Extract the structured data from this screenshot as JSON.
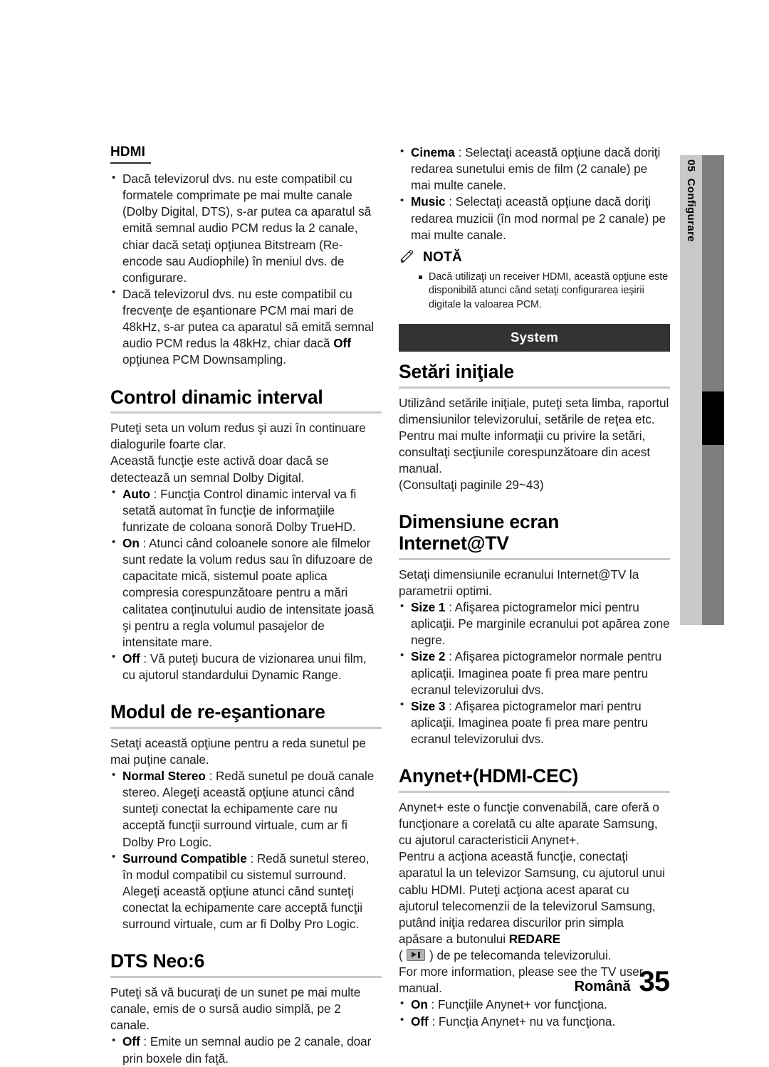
{
  "document": {
    "side_tab": {
      "number": "05",
      "label": "Configurare"
    },
    "footer": {
      "language": "Română",
      "page_number": "35"
    }
  },
  "left_column": {
    "hdmi": {
      "heading": "HDMI",
      "bullets": [
        "Dacă televizorul dvs. nu este compatibil cu formatele comprimate pe mai multe canale (Dolby Digital, DTS), s-ar putea ca aparatul să emită semnal audio PCM redus la 2 canale, chiar dacă setaţi opţiunea Bitstream (Re-encode sau Audiophile) în meniul dvs. de configurare.",
        "Dacă televizorul dvs. nu este compatibil cu frecvenţe de eşantionare PCM mai mari de 48kHz, s-ar putea ca aparatul să emită semnal audio PCM redus la 48kHz, chiar dacă Off opţiunea PCM Downsampling."
      ],
      "bullet2_bold": "Off"
    },
    "dynamic_range": {
      "heading": "Control dinamic interval",
      "intro": [
        "Puteţi seta un volum redus şi auzi în continuare dialogurile foarte clar.",
        "Această funcţie este activă doar dacă se detectează un semnal Dolby Digital."
      ],
      "options": [
        {
          "name": "Auto",
          "sep": " : ",
          "text": "Funcţia Control dinamic interval va fi setată automat în funcţie de informaţiile funrizate de coloana sonoră Dolby TrueHD."
        },
        {
          "name": "On",
          "sep": " : ",
          "text": "Atunci când coloanele sonore ale filmelor sunt redate la volum redus sau în difuzoare de capacitate mică, sistemul poate aplica compresia corespunzătoare pentru a mări calitatea conţinutului audio de intensitate joasă şi pentru a regla volumul pasajelor de intensitate mare."
        },
        {
          "name": "Off",
          "sep": " : ",
          "text": "Vă puteţi bucura de vizionarea unui film, cu ajutorul standardului Dynamic Range."
        }
      ]
    },
    "downmixing": {
      "heading": "Modul de re-eşantionare",
      "intro": "Setaţi această opţiune pentru a reda sunetul pe mai puţine canale.",
      "options": [
        {
          "name": "Normal Stereo",
          "sep": " : ",
          "text": "Redă sunetul pe două canale stereo. Alegeţi această opţiune atunci când sunteţi conectat la echipamente care nu acceptă funcţii surround virtuale, cum ar fi Dolby Pro Logic."
        },
        {
          "name": "Surround Compatible",
          "sep": " : ",
          "text": "Redă sunetul stereo, în modul compatibil cu sistemul surround. Alegeţi această opţiune atunci când sunteţi conectat la echipamente care acceptă funcţii surround virtuale, cum ar fi Dolby Pro Logic."
        }
      ]
    },
    "dts_neo6": {
      "heading": "DTS Neo:6",
      "intro": "Puteţi să vă bucuraţi de un sunet pe mai multe canale, emis de o sursă audio simplă, pe 2 canale.",
      "options": [
        {
          "name": "Off",
          "sep": " : ",
          "text": "Emite un semnal audio pe 2 canale, doar prin boxele din faţă."
        }
      ]
    }
  },
  "right_column": {
    "top_options": [
      {
        "name": "Cinema",
        "sep": " : ",
        "text": "Selectaţi această opţiune dacă doriţi redarea sunetului emis de film (2 canale) pe mai multe canele."
      },
      {
        "name": "Music",
        "sep": " : ",
        "text": "Selectaţi această opţiune dacă doriţi redarea muzicii (în mod normal pe 2 canale) pe mai multe canale."
      }
    ],
    "note": {
      "icon": "pencil-icon",
      "title": "NOTĂ",
      "items": [
        "Dacă utilizaţi un receiver HDMI, această opţiune este disponibilă atunci când setaţi configurarea ieşirii digitale la valoarea PCM."
      ]
    },
    "system_band": "System",
    "initial_settings": {
      "heading": "Setări iniţiale",
      "paragraphs": [
        "Utilizând setările iniţiale, puteţi seta limba, raportul dimensiunilor televizorului, setările de reţea etc. Pentru mai multe informaţii cu privire la setări, consultaţi secţiunile corespunzătoare din acest manual.",
        "(Consultaţi paginile 29~43)"
      ]
    },
    "internet_tv_size": {
      "heading": "Dimensiune ecran Internet@TV",
      "intro": "Setaţi dimensiunile ecranului Internet@TV la parametrii optimi.",
      "options": [
        {
          "name": "Size 1",
          "sep": " : ",
          "text": "Afişarea pictogramelor mici pentru aplicaţii. Pe marginile ecranului pot apărea zone negre."
        },
        {
          "name": "Size 2",
          "sep": " : ",
          "text": "Afişarea pictogramelor normale pentru aplicaţii. Imaginea poate fi prea mare pentru ecranul televizorului dvs."
        },
        {
          "name": "Size 3",
          "sep": " : ",
          "text": "Afişarea pictogramelor mari pentru aplicaţii. Imaginea poate fi prea mare pentru ecranul televizorului dvs."
        }
      ]
    },
    "anynet": {
      "heading": "Anynet+(HDMI-CEC)",
      "paragraph_1": "Anynet+ este o funcţie convenabilă, care oferă o funcţionare a corelată cu alte aparate Samsung, cu ajutorul caracteristicii Anynet+.",
      "paragraph_2_a": "Pentru a acţiona această funcţie, conectaţi aparatul la un televizor Samsung, cu ajutorul unui cablu HDMI. Puteţi acţiona acest aparat cu ajutorul telecomenzii de la televizorul Samsung, putând iniţia redarea discurilor prin simpla apăsare a butonului ",
      "paragraph_2_bold": "REDARE",
      "paragraph_2_b": "( ",
      "paragraph_2_c": " ) de pe telecomanda televizorului.",
      "paragraph_3": "For more information, please see the TV user manual.",
      "options": [
        {
          "name": "On",
          "sep": " : ",
          "text": "Funcţiile Anynet+ vor funcţiona."
        },
        {
          "name": "Off",
          "sep": " : ",
          "text": "Funcţia Anynet+ nu va funcţiona."
        }
      ]
    }
  },
  "colors": {
    "band_bg": "#333333",
    "rule_light": "#c9c9c9",
    "rule_dark": "#2b2b2b",
    "tab_light": "#c8c8c8",
    "tab_dark": "#7e7e7e",
    "tab_marker": "#000000"
  }
}
